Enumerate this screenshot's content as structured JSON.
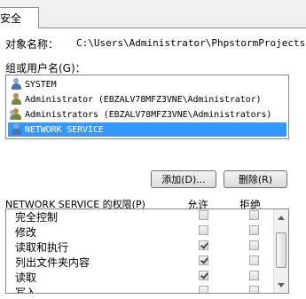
{
  "tabs": [
    {
      "label": "安全"
    }
  ],
  "object": {
    "label": "对象名称：",
    "path": "C:\\Users\\Administrator\\PhpstormProjects\\"
  },
  "principals": {
    "label": "组或用户名(G)：",
    "items": [
      {
        "name": "SYSTEM",
        "icon": "system-user-icon",
        "selected": false
      },
      {
        "name": "Administrator (EBZALV78MFZ3VNE\\Administrator)",
        "icon": "user-icon",
        "selected": false
      },
      {
        "name": "Administrators (EBZALV78MFZ3VNE\\Administrators)",
        "icon": "group-icon",
        "selected": false
      },
      {
        "name": "NETWORK SERVICE",
        "icon": "service-group-icon",
        "selected": true
      }
    ]
  },
  "buttons": {
    "add": "添加(D)...",
    "remove": "删除(R)"
  },
  "permissions": {
    "header": "NETWORK SERVICE 的权限(P)",
    "allow_label": "允许",
    "deny_label": "拒绝",
    "rows": [
      {
        "name": "完全控制",
        "allow": false,
        "deny": false
      },
      {
        "name": "修改",
        "allow": false,
        "deny": false
      },
      {
        "name": "读取和执行",
        "allow": true,
        "deny": false
      },
      {
        "name": "列出文件夹内容",
        "allow": true,
        "deny": false
      },
      {
        "name": "读取",
        "allow": true,
        "deny": false
      },
      {
        "name": "写入",
        "allow": false,
        "deny": false
      }
    ]
  },
  "colors": {
    "selection": "#3399ff",
    "panel": "#ffffff",
    "window": "#f0f0f0"
  }
}
